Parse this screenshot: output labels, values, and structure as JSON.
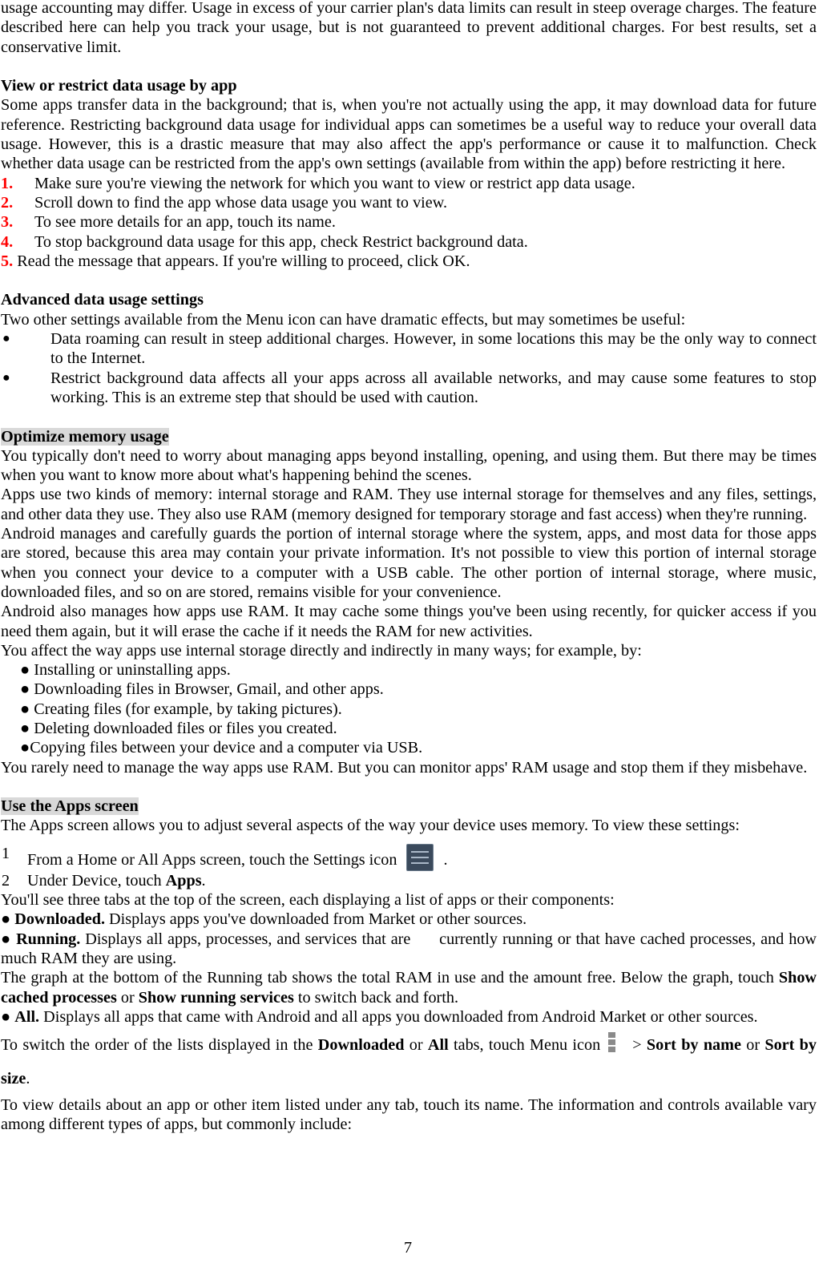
{
  "intro": {
    "text": "usage accounting may differ. Usage in excess of your carrier plan's data limits can result in steep overage charges. The feature described here can help you track your usage, but is not guaranteed to prevent additional charges. For best results, set a conservative limit."
  },
  "view_restrict": {
    "heading": "View or restrict data usage by app",
    "body": "Some apps transfer data in the background; that is, when you're not actually using the app, it may download data for future reference. Restricting background data usage for individual apps can sometimes be a useful way to reduce your overall data usage. However, this is a drastic measure that may also affect the app's performance or cause it to malfunction. Check whether data usage can be restricted from the app's own settings (available from within the app) before restricting it here.",
    "steps": [
      {
        "num": "1.",
        "text": "Make sure you're viewing the network for which you want to view or restrict app data usage."
      },
      {
        "num": "2.",
        "text": "Scroll down to find the app whose data usage you want to view."
      },
      {
        "num": "3.",
        "text": "To see more details for an app, touch its name."
      },
      {
        "num": "4.",
        "text": "To stop background data usage for this app, check Restrict background data."
      },
      {
        "num": "5.",
        "text": " Read the message that appears. If you're willing to proceed, click OK."
      }
    ]
  },
  "advanced": {
    "heading": "Advanced data usage settings",
    "intro": "Two other settings available from the Menu icon can have dramatic effects, but may sometimes be useful:",
    "bullets": [
      "Data roaming can result in steep additional charges. However, in some locations this may be the only way to connect to the Internet.",
      "Restrict background data affects all your apps across all available networks, and may cause some features to stop working. This is an extreme step that should be used with caution."
    ],
    "bullet_glyph": "●"
  },
  "optimize": {
    "heading": "Optimize memory usage",
    "paragraphs": [
      "You typically don't need to worry about managing apps beyond installing, opening, and using them. But there may be times when you want to know more about what's happening behind the scenes.",
      "Apps use two kinds of memory: internal storage and RAM. They use internal storage for themselves and any files, settings, and other data they use. They also use RAM (memory designed for temporary storage and fast access) when they're running.",
      "Android manages and carefully guards the portion of internal storage where the system, apps, and most data for those apps are stored, because this area may contain your private information. It's not possible to view this portion of internal storage when you connect your device to a computer with a USB cable. The other portion of internal storage, where music, downloaded files, and so on are stored, remains visible for your convenience.",
      "Android also manages how apps use RAM. It may cache some things you've been using recently, for quicker access if you need them again, but it will erase the cache if it needs the RAM for new activities.",
      "You affect the way apps use internal storage directly and indirectly in many ways; for example, by:"
    ],
    "list": [
      "● Installing or uninstalling apps.",
      "● Downloading files in Browser, Gmail, and other apps.",
      "● Creating files (for example, by taking pictures).",
      "● Deleting downloaded files or files you created.",
      "●Copying files between your device and a computer via USB."
    ],
    "closing": "You rarely need to manage the way apps use RAM. But you can monitor apps' RAM usage and stop them if they misbehave."
  },
  "apps_screen": {
    "heading": "Use the Apps screen",
    "intro": "The Apps screen allows you to adjust several aspects of the way your device uses memory. To view these settings:",
    "step1": {
      "num": "1",
      "text": "From a Home or All Apps screen, touch the Settings icon",
      "after": "."
    },
    "step2": {
      "num": "2",
      "text": "Under Device, touch ",
      "bold": "Apps",
      "after": "."
    },
    "tabs_intro": "You'll see three tabs at the top of the screen, each displaying a list of apps or their components:",
    "downloaded": {
      "bullet": "● ",
      "label": "Downloaded.",
      "text": " Displays apps you've downloaded from Market or other sources."
    },
    "running": {
      "bullet": "● ",
      "label": "Running.",
      "text": " Displays all apps, processes, and services that are      currently running or that have cached processes, and how much RAM they are using."
    },
    "graph": {
      "pre": "The graph at the bottom of the Running tab shows the total RAM in use and the amount free. Below the graph, touch ",
      "b1": "Show cached processes",
      "mid": " or ",
      "b2": "Show running services",
      "post": " to switch back and forth."
    },
    "all": {
      "bullet": "● ",
      "label": "All.",
      "text": " Displays all apps that came with Android and all apps you downloaded from Android Market or other sources."
    },
    "sort": {
      "pre": "To switch the order of the lists displayed in the ",
      "b1": "Downloaded",
      "mid1": " or ",
      "b2": "All",
      "mid2": " tabs, touch Menu icon",
      "gt": "> ",
      "b3": "Sort by name",
      "mid3": " or ",
      "b4": "Sort by size",
      "post": "."
    },
    "details": "To view details about an app or other item listed under any tab, touch its name. The information and controls available vary among different types of apps, but commonly include:"
  },
  "page_number": "7",
  "icons": {
    "settings": "settings-icon",
    "menu": "menu-icon"
  },
  "colors": {
    "step_number": "#ff0000",
    "heading_highlight": "#d9d9d9",
    "text": "#000000"
  }
}
